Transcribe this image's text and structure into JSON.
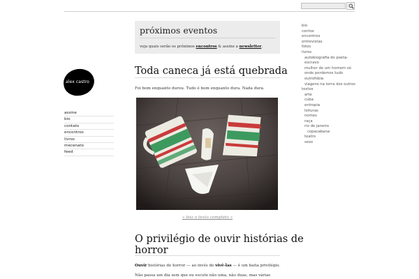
{
  "header": {
    "search_placeholder": ""
  },
  "logo": {
    "text": "alex castro"
  },
  "left_nav": [
    {
      "label": "assine"
    },
    {
      "label": "bio"
    },
    {
      "label": "contato"
    },
    {
      "label": "encontros"
    },
    {
      "label": "livros"
    },
    {
      "label": "mecenato"
    },
    {
      "label": "feed"
    }
  ],
  "events": {
    "title": "próximos eventos",
    "text_before": "veja quais serão os próximos ",
    "link1": "encontros",
    "text_middle": " & assine a ",
    "link2": "newsletter",
    "text_after": "."
  },
  "posts": [
    {
      "title": "Toda caneca já está quebrada",
      "excerpt": "Foi bom enquanto durou. Tudo é bom enquanto dura. Nada dura.",
      "read_more": "» leia o texto completo »"
    },
    {
      "title_line1": "O privilégio de ouvir histórias de",
      "title_line2": "horror",
      "excerpt1_bold1": "Ouvir",
      "excerpt1_mid": " histórias de horror — ao invés de ",
      "excerpt1_bold2": "vivê-las",
      "excerpt1_end": " — é um baita privilégio.",
      "excerpt2": "Não passa um dia sem que eu escute não uma, não duas, mas várias"
    }
  ],
  "right_nav": {
    "items": [
      {
        "label": "bio"
      },
      {
        "label": "contos"
      },
      {
        "label": "encontros"
      },
      {
        "label": "entrevistas"
      },
      {
        "label": "fotos"
      },
      {
        "label": "livros"
      }
    ],
    "livros_sub": [
      {
        "label": "autobiografia do poeta-"
      },
      {
        "label": "escravo"
      },
      {
        "label": "mulher de um homem só"
      },
      {
        "label": "onde perdemos tudo"
      },
      {
        "label": "outrofobia"
      },
      {
        "label": "viagens na terra dos outros"
      }
    ],
    "textos": {
      "label": "textos"
    },
    "textos_sub": [
      {
        "label": "arte"
      },
      {
        "label": "cuba"
      },
      {
        "label": "entropia"
      },
      {
        "label": "leituras"
      },
      {
        "label": "nomes"
      },
      {
        "label": "raça"
      },
      {
        "label": "rio de janeiro"
      },
      {
        "label": "copacabana"
      },
      {
        "label": "teatro"
      },
      {
        "label": "sexo"
      }
    ]
  }
}
